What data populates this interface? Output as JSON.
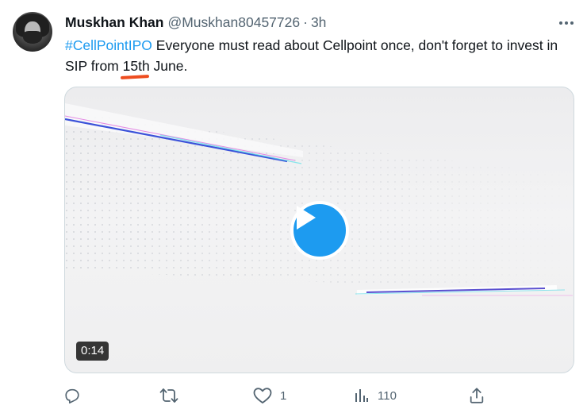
{
  "tweet": {
    "author_name": "Muskhan Khan",
    "handle": "@Muskhan80457726",
    "separator": "·",
    "time": "3h",
    "text_hashtag": "#CellPointIPO",
    "text_part1": " Everyone must read about Cellpoint once, don't forget to invest in ",
    "text_highlight": "SIP",
    "text_part2": " from 15th June."
  },
  "media": {
    "duration": "0:14"
  },
  "actions": {
    "reply_count": "",
    "retweet_count": "",
    "like_count": "1",
    "views_count": "110"
  },
  "colors": {
    "accent": "#1d9bf0",
    "secondary_text": "#536471",
    "annotation_underline": "#ee4d1f"
  },
  "icons": [
    "more-icon",
    "play-icon",
    "reply-icon",
    "retweet-icon",
    "like-icon",
    "views-icon",
    "share-icon"
  ]
}
